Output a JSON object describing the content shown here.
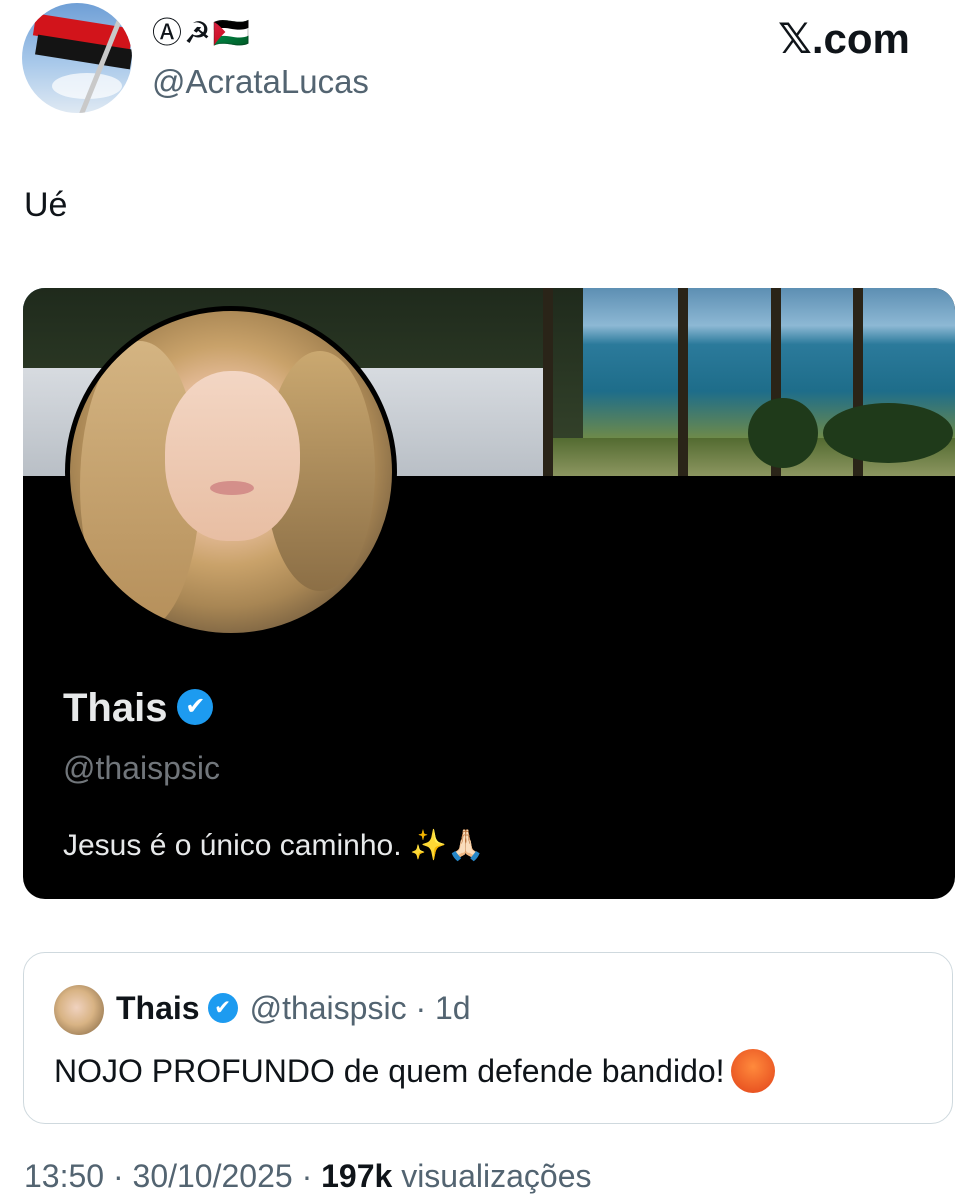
{
  "tweet": {
    "author_display_name": "Ⓐ☭🇵🇸",
    "author_handle": "@AcrataLucas",
    "site_logo": "𝕏.com",
    "text": "Ué"
  },
  "profile_card": {
    "name": "Thais",
    "verified_icon": "✔",
    "handle": "@thaispsic",
    "bio": "Jesus é o único caminho. ✨🙏🏻"
  },
  "quoted_tweet": {
    "name": "Thais",
    "verified_icon": "✔",
    "handle_time": "@thaispsic · 1d",
    "text": "NOJO PROFUNDO de quem defende bandido!"
  },
  "footer": {
    "time": "13:50",
    "separator": "·",
    "date": "30/10/2025",
    "views_count": "197k",
    "views_label": "visualizações"
  },
  "colors": {
    "verified_blue": "#1d9bf0",
    "secondary_text": "#536471",
    "card_background": "#000000"
  },
  "icons": [
    "avatar-flag-icon",
    "verified-badge-icon",
    "angry-face-icon"
  ]
}
